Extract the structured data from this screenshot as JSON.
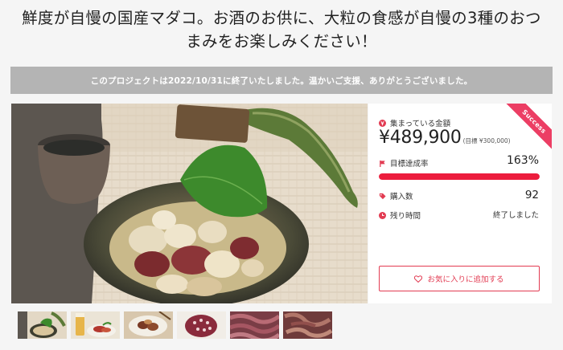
{
  "project": {
    "title_line1": "鮮度が自慢の国産マダコ。お酒のお供に、大粒の食感が自慢の3種のおつ",
    "title_line2": "まみをお楽しみください！"
  },
  "notice": "このプロジェクトは2022/10/31に終了いたしました。温かいご支援、ありがとうございました。",
  "funding": {
    "ribbon": "Success",
    "raised_label": "集まっている金額",
    "raised_amount": "¥489,900",
    "goal_text": "(目標 ¥300,000)",
    "achievement_label": "目標達成率",
    "achievement_value": "163%",
    "progress_fraction": 1.0,
    "backers_label": "購入数",
    "backers_value": "92",
    "time_label": "残り時間",
    "time_value": "終了しました",
    "favorite_button": "お気に入りに追加する"
  },
  "gallery": {
    "thumbnail_count": 6
  },
  "colors": {
    "accent_red": "#ec1d3d",
    "ribbon_pink": "#ec3e64",
    "notice_gray": "#b4b4b4"
  },
  "icons": [
    "yen-coin-icon",
    "flag-icon",
    "tag-icon",
    "clock-icon",
    "heart-icon"
  ]
}
